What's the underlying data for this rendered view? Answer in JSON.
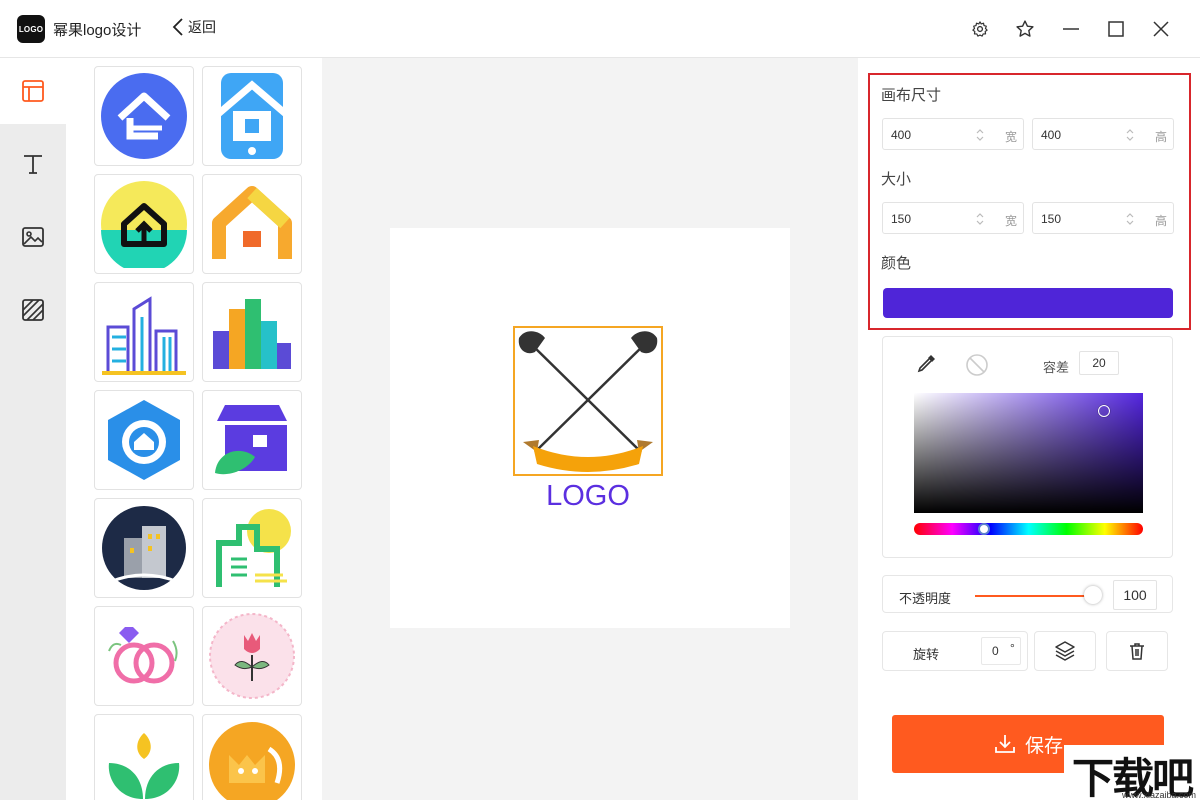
{
  "app": {
    "logo_text": "LOGO",
    "title": "幂果logo设计",
    "back_label": "返回"
  },
  "window_controls": [
    "gear-icon",
    "star-icon",
    "minimize-icon",
    "maximize-icon",
    "close-icon"
  ],
  "rail": {
    "items": [
      {
        "name": "template-icon",
        "active": true
      },
      {
        "name": "text-icon",
        "active": false
      },
      {
        "name": "image-icon",
        "active": false
      },
      {
        "name": "background-icon",
        "active": false
      }
    ]
  },
  "logo_library": {
    "items": [
      "house-circle-blue",
      "house-phone-blue",
      "house-circle-yellow",
      "house-gradient-orange",
      "city-skyline-outline",
      "city-skyline-color",
      "hexagon-house-blue",
      "shop-leaf-purple",
      "building-night-circle",
      "building-green-sun",
      "rings-diamond-pink",
      "rose-badge-pink",
      "plant-leaves-green",
      "cat-circle-orange"
    ]
  },
  "canvas": {
    "logo_text": "LOGO",
    "logo_text_color": "#5b2fe0",
    "selection_color": "#f5a623"
  },
  "panel": {
    "canvas_size": {
      "label": "画布尺寸",
      "width": "400",
      "height": "400",
      "width_unit": "宽",
      "height_unit": "高"
    },
    "size": {
      "label": "大小",
      "width": "150",
      "height": "150",
      "width_unit": "宽",
      "height_unit": "高"
    },
    "color": {
      "label": "颜色",
      "value": "#4f25d8"
    },
    "picker": {
      "tolerance_label": "容差",
      "tolerance": "20"
    },
    "opacity": {
      "label": "不透明度",
      "value": "100"
    },
    "rotate": {
      "label": "旋转",
      "value": "0",
      "unit": "°"
    },
    "save_label": "保存"
  },
  "watermark": {
    "text": "下载吧",
    "url": "www.xiazaiba.com"
  },
  "colors": {
    "accent": "#ff5a1f",
    "highlight_border": "#d8262c"
  }
}
